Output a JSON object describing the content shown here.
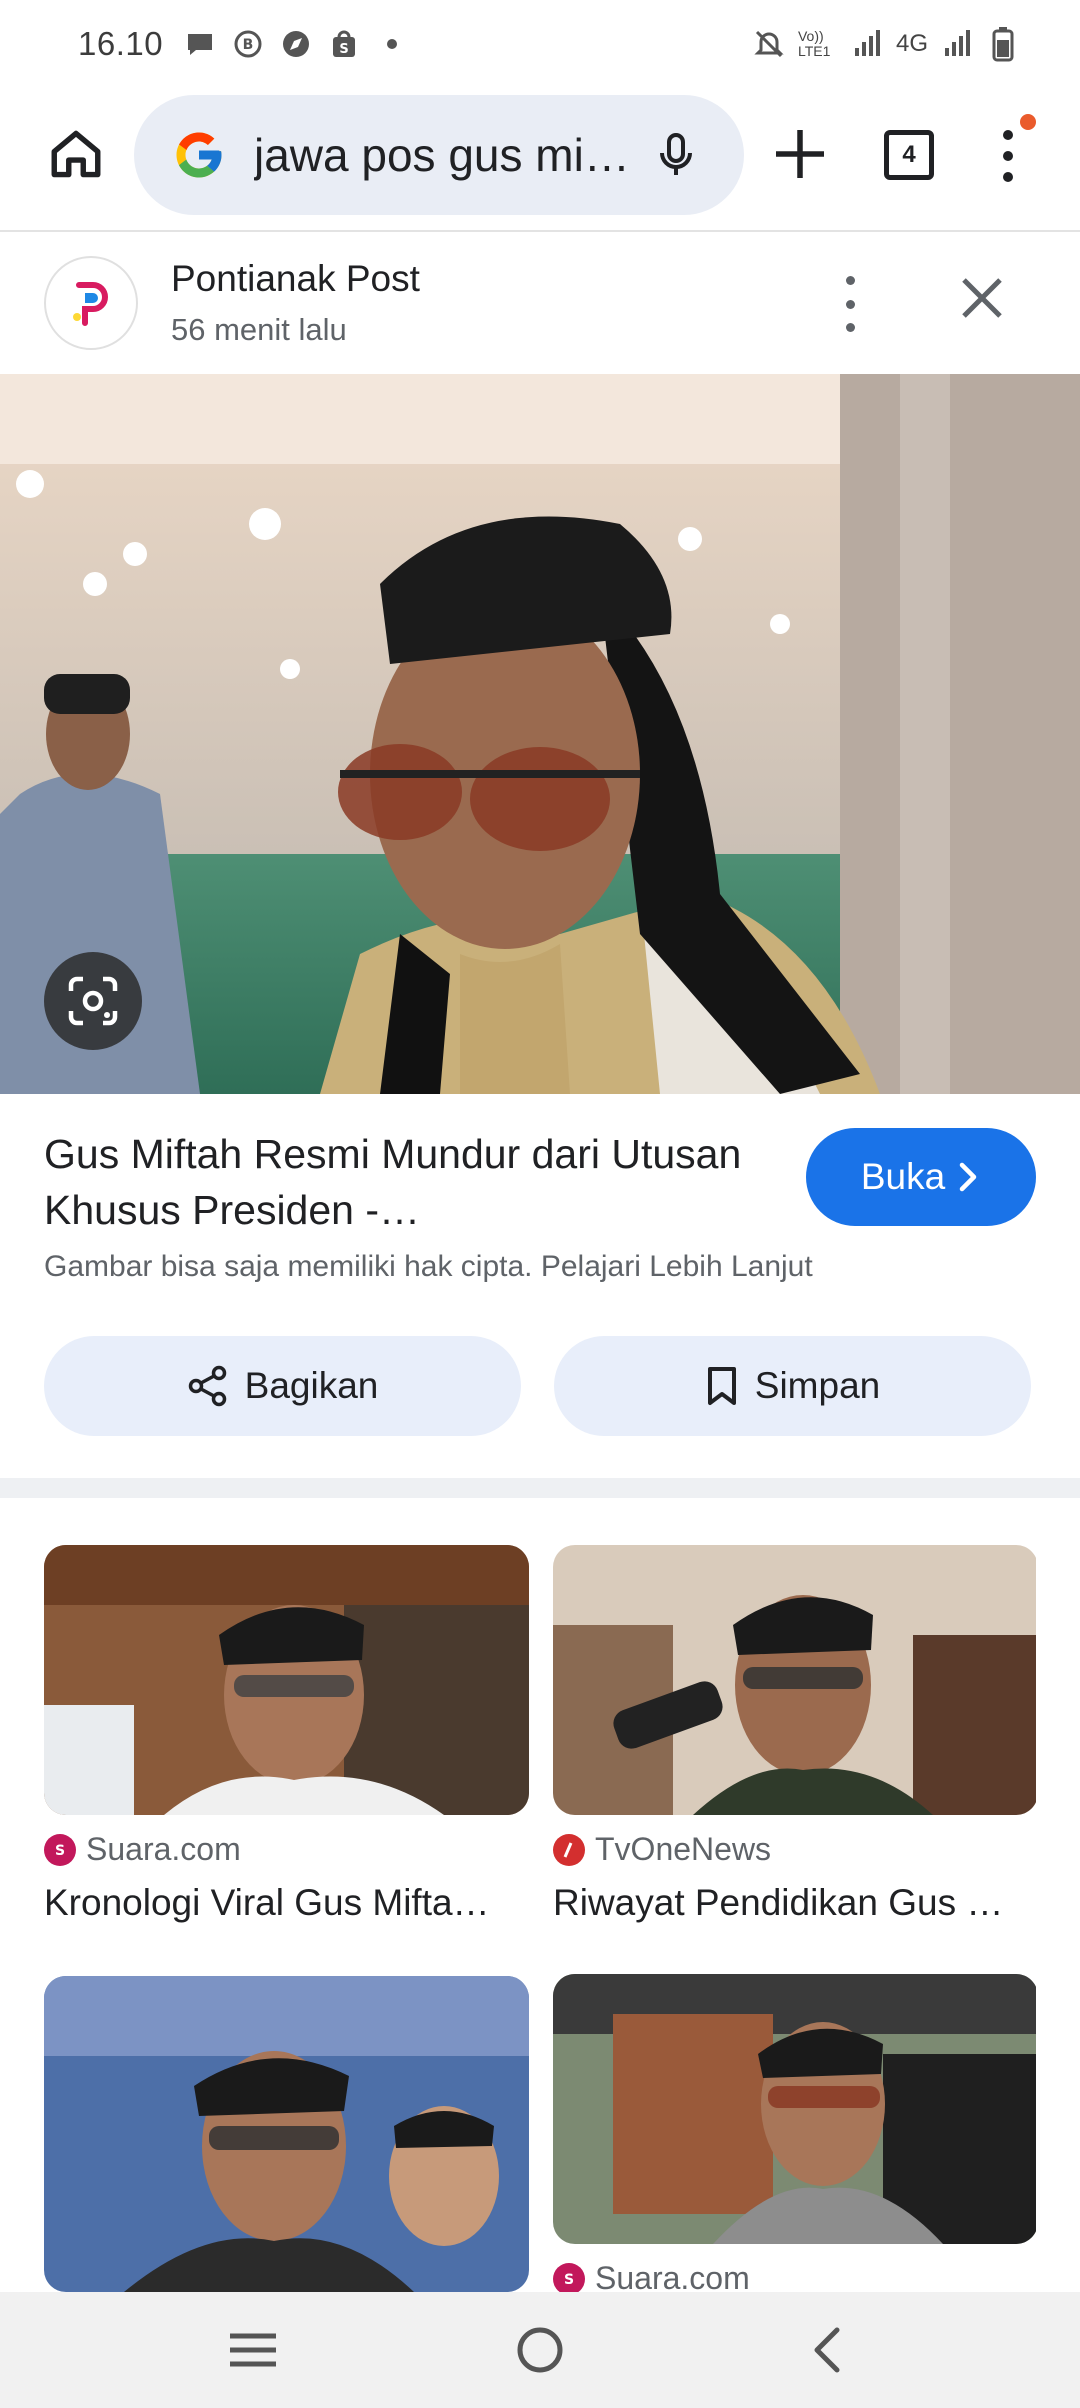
{
  "status_bar": {
    "time": "16.10",
    "network": "4G",
    "volte": "Vo)) LTE1"
  },
  "toolbar": {
    "search_query": "jawa pos gus mif…",
    "tab_count": "4"
  },
  "source": {
    "name": "Pontianak Post",
    "time_ago": "56 menit lalu"
  },
  "result": {
    "title": "Gus Miftah Resmi Mundur dari Utusan Khusus Presiden -…",
    "open_label": "Buka",
    "copyright_note": "Gambar bisa saja memiliki hak cipta. Pelajari Lebih Lanjut",
    "share_label": "Bagikan",
    "save_label": "Simpan"
  },
  "related": [
    {
      "source": "Suara.com",
      "title": "Kronologi Viral Gus Mifta…",
      "source_color": "#c2185b"
    },
    {
      "source": "TvOneNews",
      "title": "Riwayat Pendidikan Gus …",
      "source_color": "#d32f2f"
    },
    {
      "source": "",
      "title": "",
      "source_color": ""
    },
    {
      "source": "Suara.com",
      "title": "",
      "source_color": "#c2185b"
    }
  ],
  "colors": {
    "accent": "#1a73e8",
    "omnibox": "#e9edf5",
    "action_button": "#e8eefa",
    "menu_badge": "#ea5b2c"
  },
  "icons": [
    "home-icon",
    "google-icon",
    "mic-icon",
    "plus-icon",
    "menu-icon",
    "close-icon",
    "lens-icon",
    "share-icon",
    "bookmark-icon",
    "recents-icon",
    "home-circle-icon",
    "back-icon"
  ]
}
